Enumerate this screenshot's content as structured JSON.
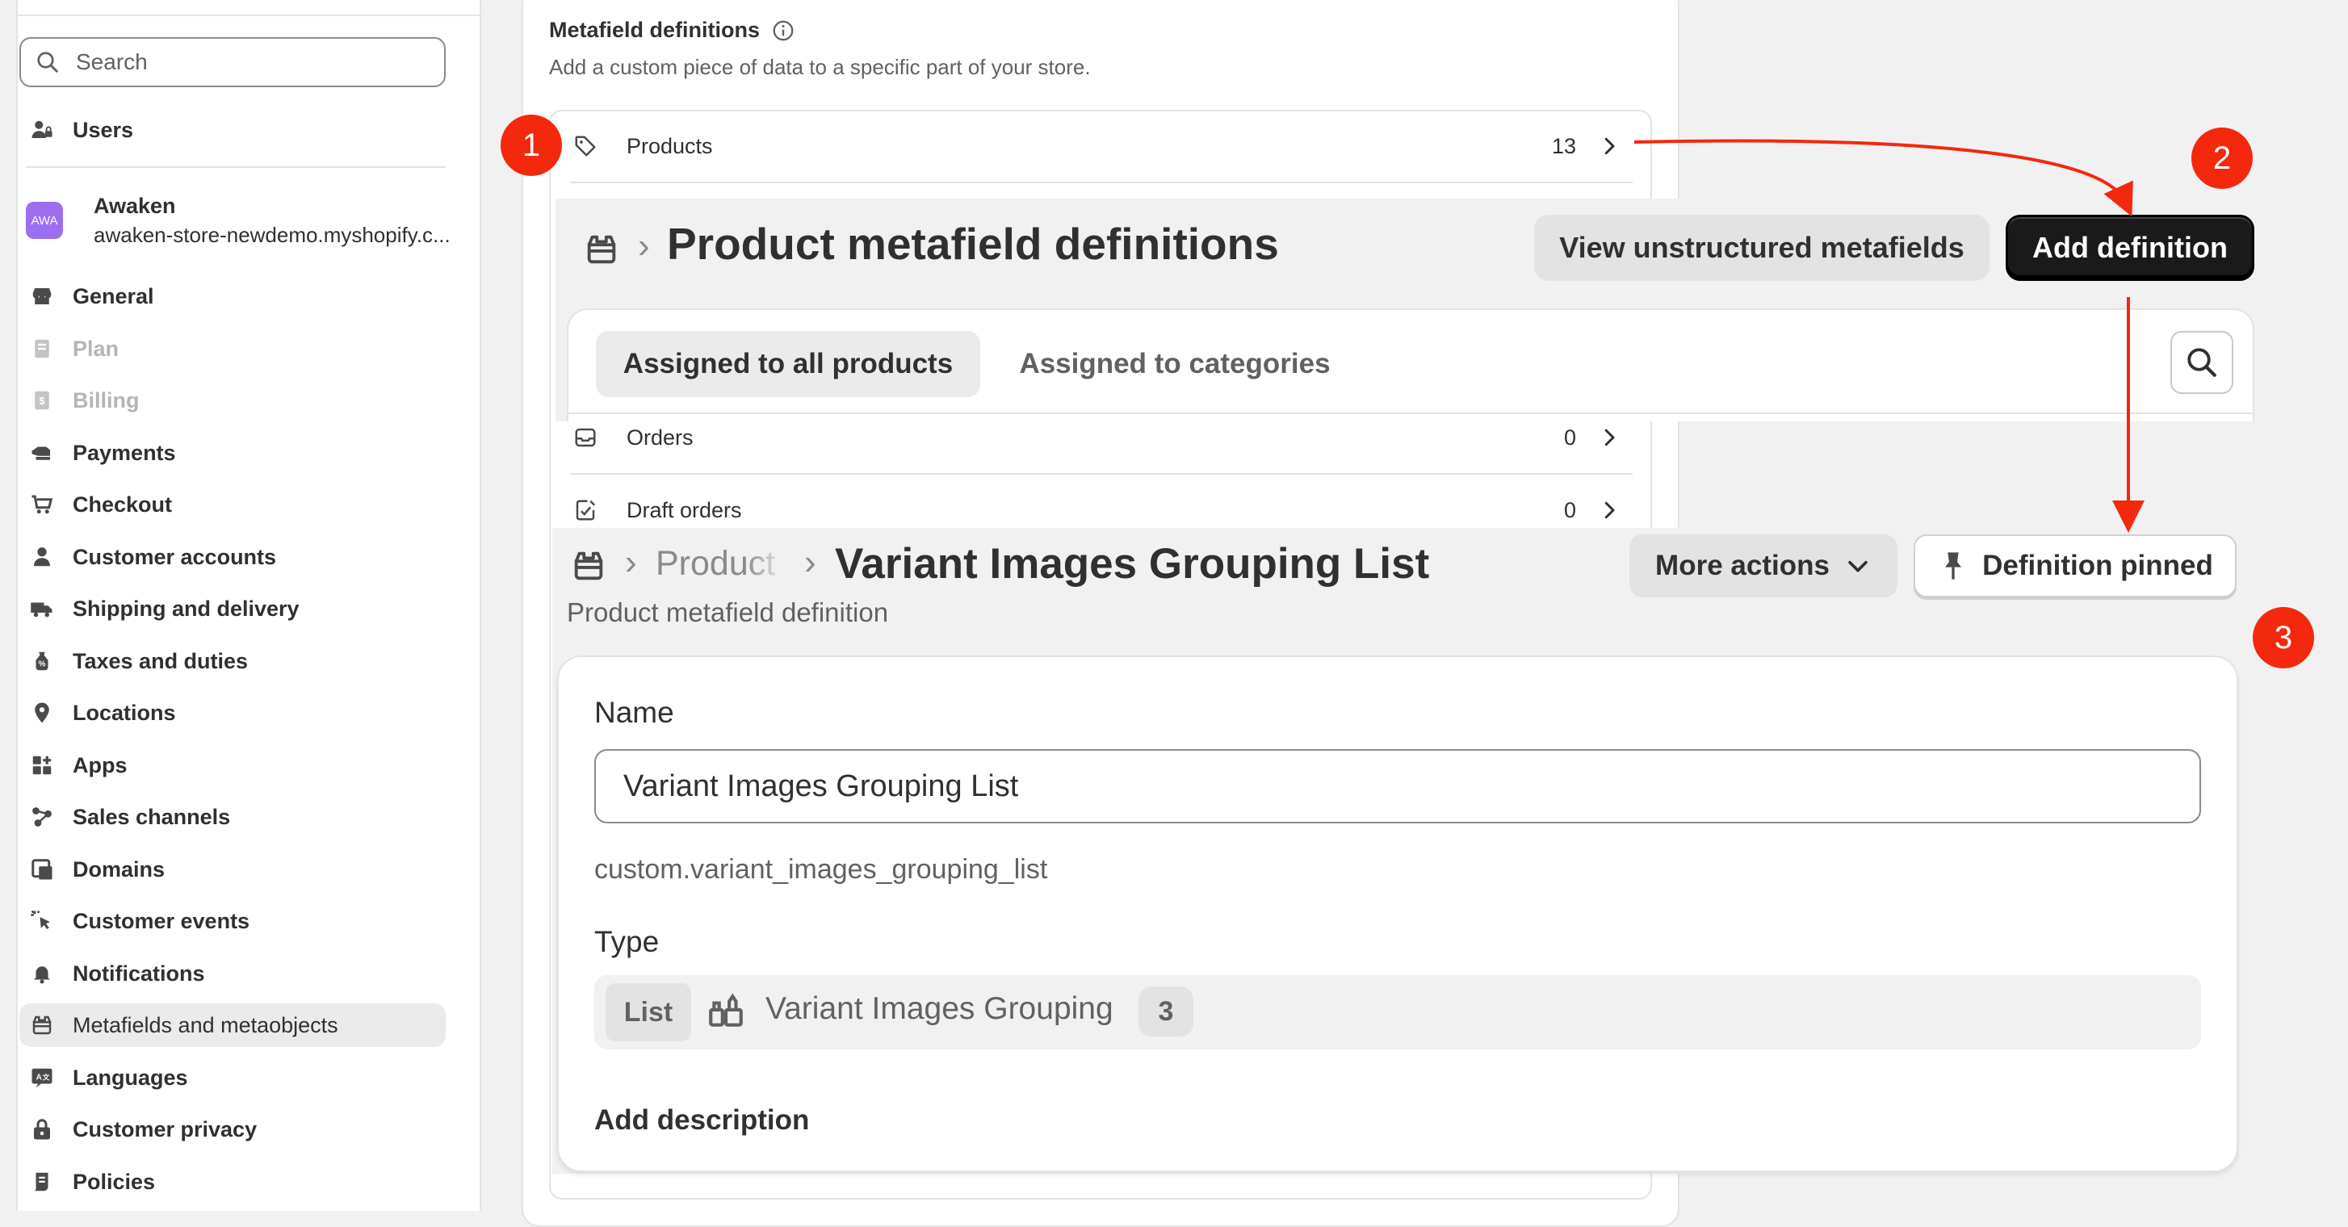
{
  "sidebar": {
    "search_placeholder": "Search",
    "users_label": "Users",
    "store": {
      "avatar_text": "AWA",
      "name": "Awaken",
      "url": "awaken-store-newdemo.myshopify.c..."
    },
    "items": [
      {
        "label": "General",
        "icon": "store-icon"
      },
      {
        "label": "Plan",
        "icon": "plan-icon",
        "disabled": true
      },
      {
        "label": "Billing",
        "icon": "billing-icon",
        "disabled": true
      },
      {
        "label": "Payments",
        "icon": "payments-icon"
      },
      {
        "label": "Checkout",
        "icon": "cart-icon"
      },
      {
        "label": "Customer accounts",
        "icon": "person-icon"
      },
      {
        "label": "Shipping and delivery",
        "icon": "truck-icon"
      },
      {
        "label": "Taxes and duties",
        "icon": "tax-icon"
      },
      {
        "label": "Locations",
        "icon": "location-icon"
      },
      {
        "label": "Apps",
        "icon": "apps-icon"
      },
      {
        "label": "Sales channels",
        "icon": "channels-icon"
      },
      {
        "label": "Domains",
        "icon": "domains-icon"
      },
      {
        "label": "Customer events",
        "icon": "cursor-icon"
      },
      {
        "label": "Notifications",
        "icon": "bell-icon"
      },
      {
        "label": "Metafields and metaobjects",
        "icon": "metafields-icon",
        "active": true
      },
      {
        "label": "Languages",
        "icon": "languages-icon"
      },
      {
        "label": "Customer privacy",
        "icon": "lock-icon"
      },
      {
        "label": "Policies",
        "icon": "policies-icon"
      }
    ]
  },
  "metafields": {
    "title": "Metafield definitions",
    "subtitle": "Add a custom piece of data to a specific part of your store.",
    "rows": [
      {
        "label": "Products",
        "count": "13",
        "icon": "tag-icon"
      },
      {
        "label": "Orders",
        "count": "0",
        "icon": "inbox-icon"
      },
      {
        "label": "Draft orders",
        "count": "0",
        "icon": "draft-order-icon"
      }
    ]
  },
  "product_defs": {
    "title": "Product metafield definitions",
    "view_unstructured": "View unstructured metafields",
    "add_definition": "Add definition",
    "tabs": [
      {
        "label": "Assigned to all products",
        "active": true
      },
      {
        "label": "Assigned to categories"
      }
    ]
  },
  "definition": {
    "breadcrumb_parent": "Product",
    "title": "Variant Images Grouping List",
    "subtitle": "Product metafield definition",
    "more_actions": "More actions",
    "pinned": "Definition pinned",
    "name_label": "Name",
    "name_value": "Variant Images Grouping List",
    "namespace_key": "custom.variant_images_grouping_list",
    "type_label": "Type",
    "type_tag": "List",
    "type_name": "Variant Images Grouping",
    "type_count": "3",
    "add_description": "Add description"
  },
  "markers": [
    "1",
    "2",
    "3"
  ],
  "colors": {
    "accent_red": "#f4280d",
    "primary_button": "#1a1a1a",
    "avatar": "#9c6ef0"
  }
}
